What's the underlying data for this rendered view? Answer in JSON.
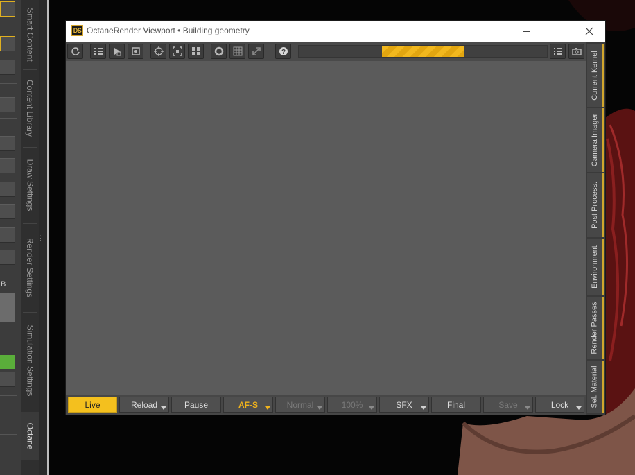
{
  "host": {
    "left_tabs": [
      "Smart Content",
      "Content Library",
      "Draw Settings",
      "Render Settings",
      "Simulation Settings",
      "Octane"
    ],
    "active_tab": "Octane",
    "field_label": "B"
  },
  "window": {
    "title": "OctaneRender Viewport • Building geometry",
    "app_icon_text": "DS",
    "caption_buttons": {
      "minimize": "minimize",
      "maximize": "maximize",
      "close": "close"
    }
  },
  "toolbar": {
    "icons": [
      "refresh-icon",
      "list-icon",
      "object-pick-icon",
      "focus-pick-icon",
      "crosshair-icon",
      "region-icon",
      "tiles-icon",
      "circle-icon",
      "grid-icon",
      "expand-icon",
      "help-icon",
      "options-list-icon",
      "camera-icon"
    ],
    "progress": 0.33
  },
  "side_tabs": [
    "Current Kernel",
    "Camera Imager",
    "Post Process.",
    "Environment",
    "Render Passes",
    "Sel. Material"
  ],
  "bottom_bar": {
    "live": "Live",
    "reload": "Reload",
    "pause": "Pause",
    "af": "AF-S",
    "normal": "Normal",
    "zoom": "100%",
    "sfx": "SFX",
    "final": "Final",
    "save": "Save",
    "lock": "Lock"
  },
  "colors": {
    "accent": "#f4c01e",
    "viewport": "#5b5b5b",
    "toolbar": "#4a4a4a"
  }
}
